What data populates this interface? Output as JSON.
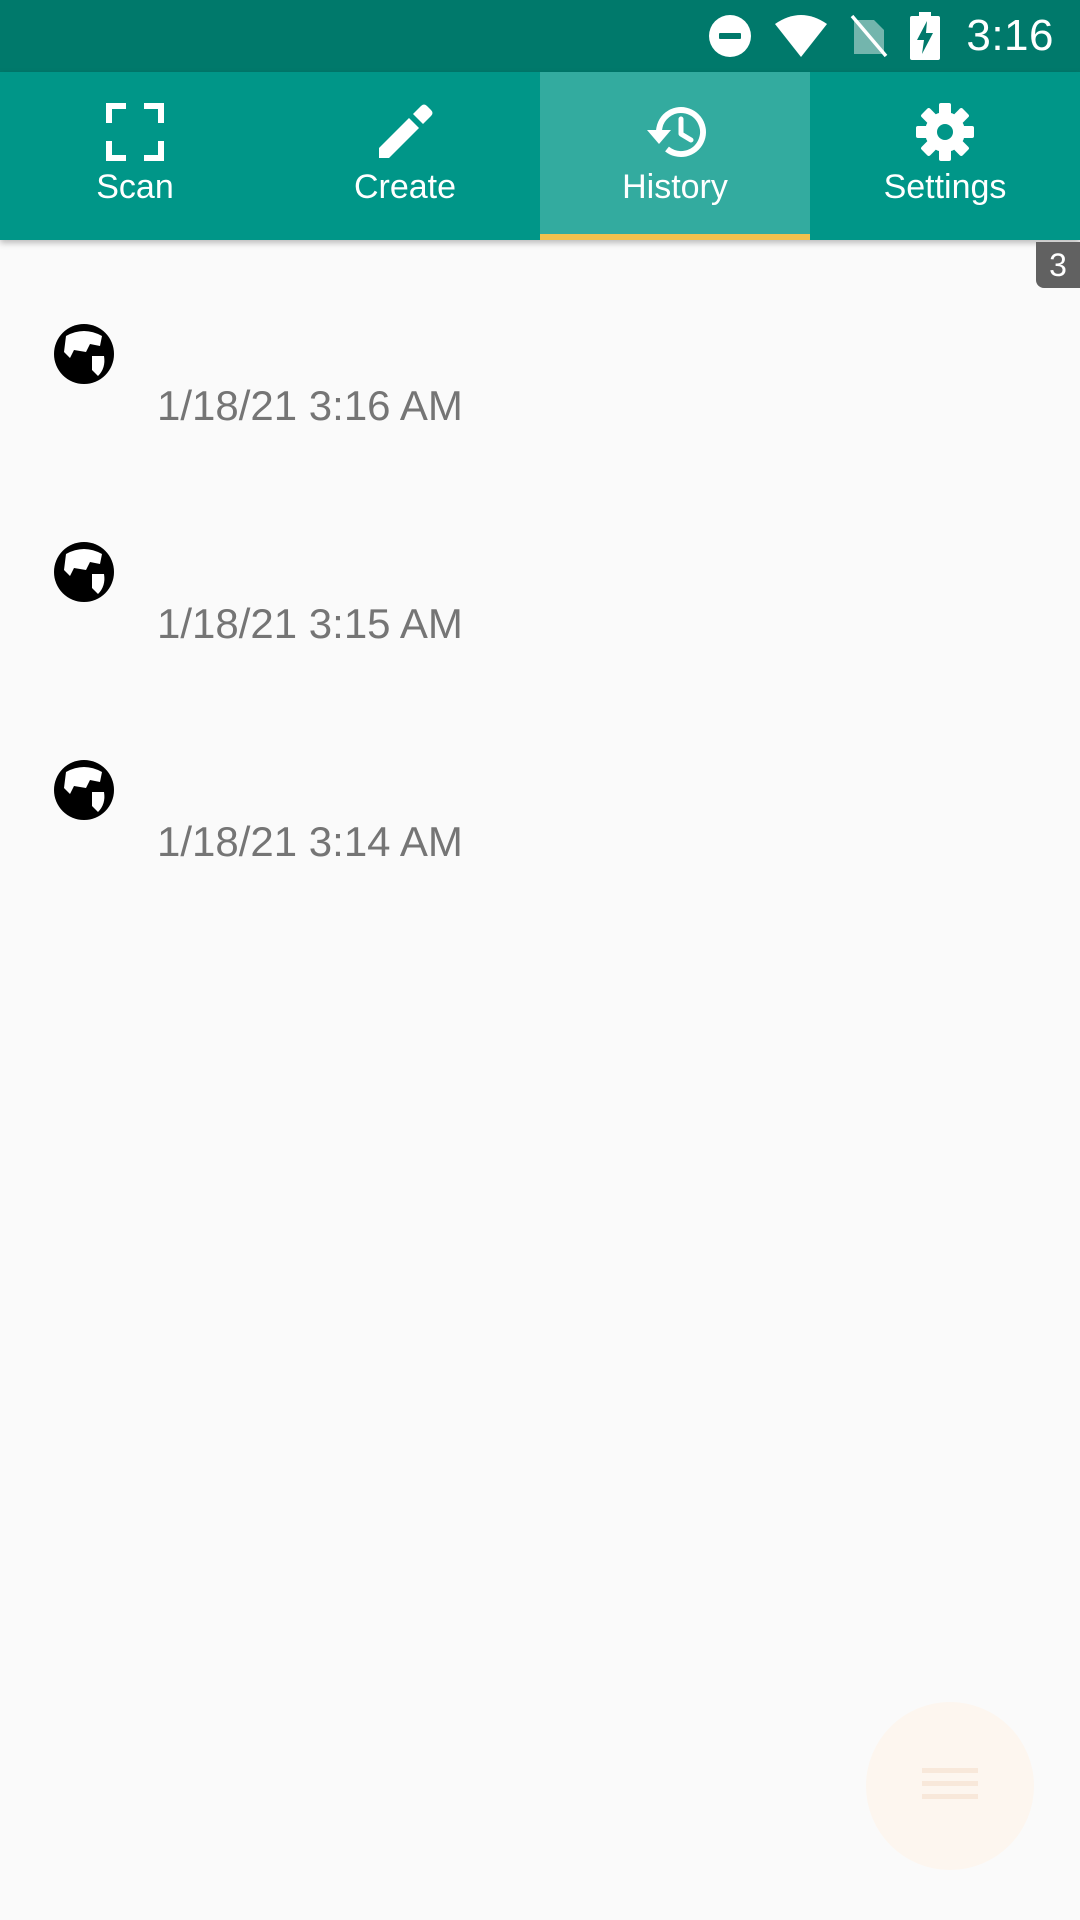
{
  "status_bar": {
    "time": "3:16",
    "icons": [
      "do-not-disturb-icon",
      "wifi-icon",
      "no-sim-icon",
      "battery-charging-icon"
    ]
  },
  "tabs": [
    {
      "label": "Scan",
      "icon": "scan-icon",
      "active": false
    },
    {
      "label": "Create",
      "icon": "pencil-icon",
      "active": false
    },
    {
      "label": "History",
      "icon": "history-icon",
      "active": true
    },
    {
      "label": "Settings",
      "icon": "gear-icon",
      "active": false
    }
  ],
  "history": {
    "count": "3",
    "items": [
      {
        "icon": "globe-icon",
        "time": "1/18/21 3:16 AM"
      },
      {
        "icon": "globe-icon",
        "time": "1/18/21 3:15 AM"
      },
      {
        "icon": "globe-icon",
        "time": "1/18/21 3:14 AM"
      }
    ]
  },
  "fab": {
    "icon": "menu-icon"
  },
  "colors": {
    "status_bar": "#00796b",
    "tab_bar": "#009688",
    "tab_active": "#33ab9f",
    "indicator": "#f2c14e",
    "background": "#fafafa",
    "timestamp_text": "#757575"
  }
}
